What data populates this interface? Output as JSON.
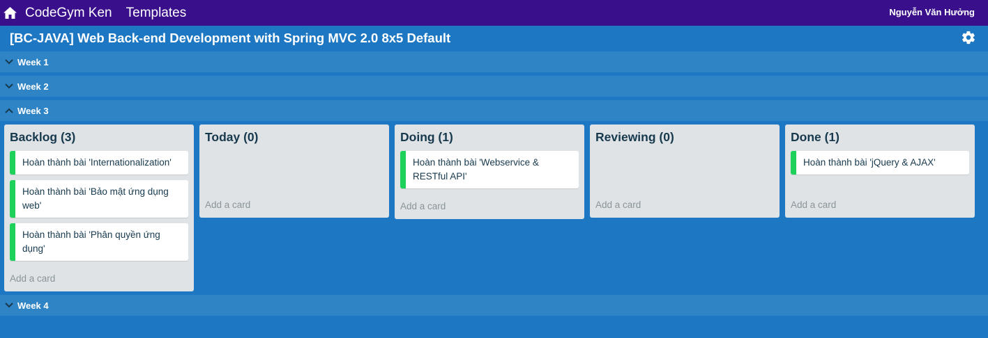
{
  "topbar": {
    "icon": "home-icon",
    "brand": "CodeGym Ken",
    "templates": "Templates",
    "user": "Nguyễn Văn Hưởng",
    "background": "#3a0f8c"
  },
  "board": {
    "title": "[BC-JAVA] Web Back-end Development with Spring MVC 2.0 8x5 Default",
    "settings_icon": "gear-icon",
    "background": "#1e77c2"
  },
  "weeks": [
    {
      "label": "Week 1",
      "expanded": false
    },
    {
      "label": "Week 2",
      "expanded": false
    },
    {
      "label": "Week 3",
      "expanded": true
    },
    {
      "label": "Week 4",
      "expanded": false
    }
  ],
  "lists": [
    {
      "title": "Backlog (3)",
      "cards": [
        {
          "text": "Hoàn thành bài 'Internationalization'"
        },
        {
          "text": "Hoàn thành bài 'Bảo mật ứng dụng web'"
        },
        {
          "text": "Hoàn thành bài 'Phân quyền ứng dụng'"
        }
      ],
      "add_label": "Add a card"
    },
    {
      "title": "Today (0)",
      "cards": [],
      "add_label": "Add a card"
    },
    {
      "title": "Doing (1)",
      "cards": [
        {
          "text": "Hoàn thành bài 'Webservice & RESTful API'"
        }
      ],
      "add_label": "Add a card"
    },
    {
      "title": "Reviewing (0)",
      "cards": [],
      "add_label": "Add a card"
    },
    {
      "title": "Done (1)",
      "cards": [
        {
          "text": "Hoàn thành bài 'jQuery & AJAX'"
        }
      ],
      "add_label": "Add a card"
    }
  ],
  "colors": {
    "card_label": "#1ed15a",
    "list_background": "#dfe3e6",
    "week_row": "#2e84c5"
  }
}
